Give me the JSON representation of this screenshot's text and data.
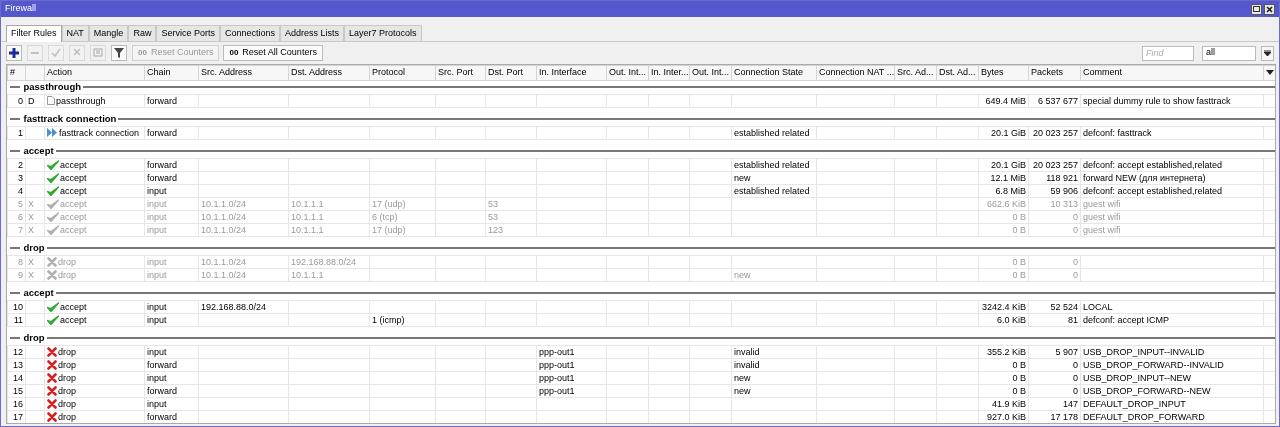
{
  "window": {
    "title": "Firewall"
  },
  "tabs": [
    {
      "label": "Filter Rules",
      "selected": true
    },
    {
      "label": "NAT",
      "selected": false
    },
    {
      "label": "Mangle",
      "selected": false
    },
    {
      "label": "Raw",
      "selected": false
    },
    {
      "label": "Service Ports",
      "selected": false
    },
    {
      "label": "Connections",
      "selected": false
    },
    {
      "label": "Address Lists",
      "selected": false
    },
    {
      "label": "Layer7 Protocols",
      "selected": false
    }
  ],
  "toolbar": {
    "icon_buttons": [
      {
        "kind": "add",
        "disabled": false
      },
      {
        "kind": "remove",
        "disabled": true
      },
      {
        "kind": "enable",
        "disabled": true
      },
      {
        "kind": "disable",
        "disabled": true
      },
      {
        "kind": "comment",
        "disabled": true
      },
      {
        "kind": "filter",
        "disabled": false
      }
    ],
    "text_buttons": [
      {
        "glyph": "00",
        "label": "Reset Counters",
        "disabled": true
      },
      {
        "glyph": "00",
        "label": "Reset All Counters",
        "disabled": false
      }
    ],
    "find": {
      "placeholder": "Find"
    },
    "scope": {
      "value": "all"
    }
  },
  "table": {
    "columns": [
      "#",
      "",
      "Action",
      "Chain",
      "Src. Address",
      "Dst. Address",
      "Protocol",
      "Src. Port",
      "Dst. Port",
      "In. Interface",
      "Out. Int...",
      "In. Inter...",
      "Out. Int...",
      "Connection State",
      "Connection NAT ...",
      "Src. Ad...",
      "Dst. Ad...",
      "Bytes",
      "Packets",
      "Comment"
    ],
    "groups": [
      {
        "title": "passthrough",
        "rules": [
          {
            "num": "0",
            "flag": "D",
            "disabled": false,
            "kind": "passthrough",
            "action": "passthrough",
            "chain": "forward",
            "bytes": "649.4 MiB",
            "packets": "6 537 677",
            "comment": "special dummy rule to show fasttrack"
          }
        ]
      },
      {
        "title": "fasttrack connection",
        "rules": [
          {
            "num": "1",
            "disabled": false,
            "kind": "fasttrack",
            "action": "fasttrack connection",
            "chain": "forward",
            "connection_state": "established related",
            "bytes": "20.1 GiB",
            "packets": "20 023 257",
            "comment": "defconf: fasttrack"
          }
        ]
      },
      {
        "title": "accept",
        "rules": [
          {
            "num": "2",
            "disabled": false,
            "kind": "accept",
            "action": "accept",
            "chain": "forward",
            "connection_state": "established related",
            "bytes": "20.1 GiB",
            "packets": "20 023 257",
            "comment": "defconf: accept established,related"
          },
          {
            "num": "3",
            "disabled": false,
            "kind": "accept",
            "action": "accept",
            "chain": "forward",
            "connection_state": "new",
            "bytes": "12.1 MiB",
            "packets": "118 921",
            "comment": "forward NEW (для интернета)"
          },
          {
            "num": "4",
            "disabled": false,
            "kind": "accept",
            "action": "accept",
            "chain": "input",
            "connection_state": "established related",
            "bytes": "6.8 MiB",
            "packets": "59 906",
            "comment": "defconf: accept established,related"
          },
          {
            "num": "5",
            "flag": "X",
            "disabled": true,
            "kind": "accept",
            "action": "accept",
            "chain": "input",
            "src_address": "10.1.1.0/24",
            "dst_address": "10.1.1.1",
            "protocol": "17 (udp)",
            "dst_port": "53",
            "bytes": "662.6 KiB",
            "packets": "10 313",
            "comment": "guest wifi"
          },
          {
            "num": "6",
            "flag": "X",
            "disabled": true,
            "kind": "accept",
            "action": "accept",
            "chain": "input",
            "src_address": "10.1.1.0/24",
            "dst_address": "10.1.1.1",
            "protocol": "6 (tcp)",
            "dst_port": "53",
            "bytes": "0 B",
            "packets": "0",
            "comment": "guest wifi"
          },
          {
            "num": "7",
            "flag": "X",
            "disabled": true,
            "kind": "accept",
            "action": "accept",
            "chain": "input",
            "src_address": "10.1.1.0/24",
            "dst_address": "10.1.1.1",
            "protocol": "17 (udp)",
            "dst_port": "123",
            "bytes": "0 B",
            "packets": "0",
            "comment": "guest wifi"
          }
        ]
      },
      {
        "title": "drop",
        "rules": [
          {
            "num": "8",
            "flag": "X",
            "disabled": true,
            "kind": "drop",
            "action": "drop",
            "chain": "input",
            "src_address": "10.1.1.0/24",
            "dst_address": "192.168.88.0/24",
            "bytes": "0 B",
            "packets": "0"
          },
          {
            "num": "9",
            "flag": "X",
            "disabled": true,
            "kind": "drop",
            "action": "drop",
            "chain": "input",
            "src_address": "10.1.1.0/24",
            "dst_address": "10.1.1.1",
            "connection_state": "new",
            "bytes": "0 B",
            "packets": "0"
          }
        ]
      },
      {
        "title": "accept",
        "rules": [
          {
            "num": "10",
            "disabled": false,
            "kind": "accept",
            "action": "accept",
            "chain": "input",
            "src_address": "192.168.88.0/24",
            "bytes": "3242.4 KiB",
            "packets": "52 524",
            "comment": "LOCAL"
          },
          {
            "num": "11",
            "disabled": false,
            "kind": "accept",
            "action": "accept",
            "chain": "input",
            "protocol": "1 (icmp)",
            "bytes": "6.0 KiB",
            "packets": "81",
            "comment": "defconf: accept ICMP"
          }
        ]
      },
      {
        "title": "drop",
        "rules": [
          {
            "num": "12",
            "disabled": false,
            "kind": "drop",
            "action": "drop",
            "chain": "input",
            "in_interface": "ppp-out1",
            "connection_state": "invalid",
            "bytes": "355.2 KiB",
            "packets": "5 907",
            "comment": "USB_DROP_INPUT--INVALID"
          },
          {
            "num": "13",
            "disabled": false,
            "kind": "drop",
            "action": "drop",
            "chain": "forward",
            "in_interface": "ppp-out1",
            "connection_state": "invalid",
            "bytes": "0 B",
            "packets": "0",
            "comment": "USB_DROP_FORWARD--INVALID"
          },
          {
            "num": "14",
            "disabled": false,
            "kind": "drop",
            "action": "drop",
            "chain": "input",
            "in_interface": "ppp-out1",
            "connection_state": "new",
            "bytes": "0 B",
            "packets": "0",
            "comment": "USB_DROP_INPUT--NEW"
          },
          {
            "num": "15",
            "disabled": false,
            "kind": "drop",
            "action": "drop",
            "chain": "forward",
            "in_interface": "ppp-out1",
            "connection_state": "new",
            "bytes": "0 B",
            "packets": "0",
            "comment": "USB_DROP_FORWARD--NEW"
          },
          {
            "num": "16",
            "disabled": false,
            "kind": "drop",
            "action": "drop",
            "chain": "input",
            "bytes": "41.9 KiB",
            "packets": "147",
            "comment": "DEFAULT_DROP_INPUT"
          },
          {
            "num": "17",
            "disabled": false,
            "kind": "drop",
            "action": "drop",
            "chain": "forward",
            "bytes": "927.0 KiB",
            "packets": "17 178",
            "comment": "DEFAULT_DROP_FORWARD"
          }
        ]
      }
    ]
  }
}
